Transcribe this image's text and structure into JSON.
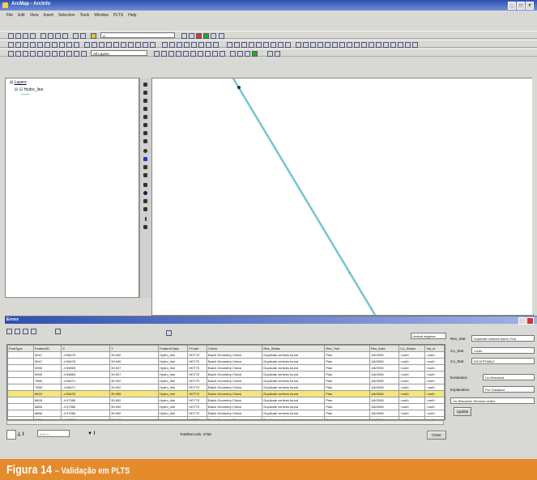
{
  "window": {
    "title": "ArcMap - ArcInfo",
    "controls": [
      "_",
      "□",
      "×"
    ]
  },
  "menu": [
    "File",
    "Edit",
    "View",
    "Insert",
    "Selection",
    "Tools",
    "Window",
    "PLTS",
    "Help"
  ],
  "toolbar": {
    "scale": "1:",
    "layers_select": "All Layers"
  },
  "toc": {
    "root": "Layers",
    "layer": "Hydro_line"
  },
  "errors": {
    "title": "Errors",
    "vertical_degrees": "Vertical degrees",
    "columns": [
      "FeatType",
      "FeatureID",
      "X",
      "Y",
      "FeatureClass",
      "FCode",
      "Check",
      "Res_Status",
      "Res_Tool",
      "Res_Date",
      "Co_Status",
      "Val_ur"
    ],
    "rows": [
      [
        "",
        "5947",
        "-4.96476",
        "39.940",
        "Hydro_line",
        "HDT70",
        "Batch Geometry Check",
        "Duplicate vertices found",
        "Plan",
        "1/8/2006",
        "<null>",
        "<null>"
      ],
      [
        "",
        "5947",
        "-4.96476",
        "39.940",
        "Hydro_line",
        "HDT70",
        "Batch Geometry Check",
        "Duplicate vertices found",
        "Plan",
        "1/8/2006",
        "<null>",
        "<null>"
      ],
      [
        "",
        "5955",
        "-4.95863",
        "39.927",
        "Hydro_line",
        "HDT70",
        "Batch Geometry Check",
        "Duplicate vertices found",
        "Plan",
        "1/8/2006",
        "<null>",
        "<null>"
      ],
      [
        "",
        "5955",
        "-4.95863",
        "39.927",
        "Hydro_line",
        "HDT70",
        "Batch Geometry Check",
        "Duplicate vertices found",
        "Plan",
        "1/8/2006",
        "<null>",
        "<null>"
      ],
      [
        "",
        "7565",
        "-4.96471",
        "39.922",
        "Hydro_line",
        "HDT70",
        "Batch Geometry Check",
        "Duplicate vertices found",
        "Plan",
        "1/8/2006",
        "<null>",
        "<null>"
      ],
      [
        "",
        "7565",
        "-4.96471",
        "39.922",
        "Hydro_line",
        "HDT70",
        "Batch Geometry Check",
        "Duplicate vertices found",
        "Plan",
        "1/8/2006",
        "<null>",
        "<null>"
      ],
      [
        "",
        "8816",
        "-4.96420",
        "39.905",
        "Hydro_line",
        "HDT70",
        "Batch Geometry Check",
        "Duplicate vertices found",
        "Plan",
        "1/8/2006",
        "<null>",
        "<null>"
      ],
      [
        "",
        "8826",
        "-4.97385",
        "39.902",
        "Hydro_line",
        "HDT70",
        "Batch Geometry Check",
        "Duplicate vertices found",
        "Plan",
        "1/8/2006",
        "<null>",
        "<null>"
      ],
      [
        "",
        "8865",
        "-4.97385",
        "39.902",
        "Hydro_line",
        "HDT70",
        "Batch Geometry Check",
        "Duplicate vertices found",
        "Plan",
        "1/8/2006",
        "<null>",
        "<null>"
      ],
      [
        "",
        "8866",
        "-4.97385",
        "39.902",
        "Hydro_line",
        "HDT70",
        "Batch Geometry Check",
        "Duplicate vertices found",
        "Plan",
        "1/8/2006",
        "<null>",
        "<null>"
      ],
      [
        "",
        "8866",
        "-4.97385",
        "39.902",
        "Hydro_line",
        "HDT70",
        "Batch Geometry Check",
        "Duplicate vertices found",
        "Plan",
        "1/8/2006",
        "<null>",
        "<null>"
      ]
    ],
    "selected_row": 6,
    "total_records": "TotalRecords: 3768",
    "filter_label": "Add to",
    "close_label": "Close"
  },
  "details": {
    "res_stat_label": "Res_Stat",
    "res_stat_value": "Duplicate vertices found. Fea",
    "co_stat_label": "Co_Stat",
    "co_stat_value": "<null>",
    "co_stat2_label": "Co_Stat",
    "co_stat2_value": "EXCEPTABLE",
    "evaluation_label": "Evaluation",
    "evaluation_value": "Un-Resolved",
    "explanation_label": "Explanation",
    "explanation_value": "Per Guidance",
    "note": "Un-Resolved: Remove vertex",
    "update_label": "Update"
  },
  "caption": {
    "figure": "Figura 14",
    "subtitle": "– Validação em PLTS"
  }
}
